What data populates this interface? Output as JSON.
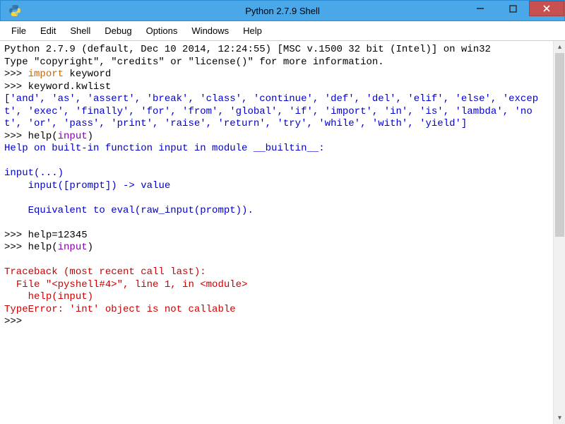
{
  "window": {
    "title": "Python 2.7.9 Shell"
  },
  "menubar": {
    "file": "File",
    "edit": "Edit",
    "shell": "Shell",
    "debug": "Debug",
    "options": "Options",
    "windows": "Windows",
    "help": "Help"
  },
  "shell": {
    "banner": "Python 2.7.9 (default, Dec 10 2014, 12:24:55) [MSC v.1500 32 bit (Intel)] on win32",
    "info": "Type \"copyright\", \"credits\" or \"license()\" for more information.",
    "prompt": ">>> ",
    "line1_kw_import": "import",
    "line1_rest": " keyword",
    "line2": "keyword.kwlist",
    "kwlist": "['and', 'as', 'assert', 'break', 'class', 'continue', 'def', 'del', 'elif', 'else', 'except', 'exec', 'finally', 'for', 'from', 'global', 'if', 'import', 'in', 'is', 'lambda', 'not', 'or', 'pass', 'print', 'raise', 'return', 'try', 'while', 'with', 'yield']",
    "line3_a": "help(",
    "line3_b": "input",
    "line3_c": ")",
    "help_header": "Help on built-in function input in module __builtin__:",
    "help_sig": "input(...)",
    "help_l1": "    input([prompt]) -> value",
    "help_l2": "    Equivalent to eval(raw_input(prompt)).",
    "line4": "help=12345",
    "line5_a": "help(",
    "line5_b": "input",
    "line5_c": ")",
    "tb_header": "Traceback (most recent call last):",
    "tb_file": "  File \"<pyshell#4>\", line 1, in <module>",
    "tb_call": "    help(input)",
    "tb_err": "TypeError: 'int' object is not callable"
  }
}
